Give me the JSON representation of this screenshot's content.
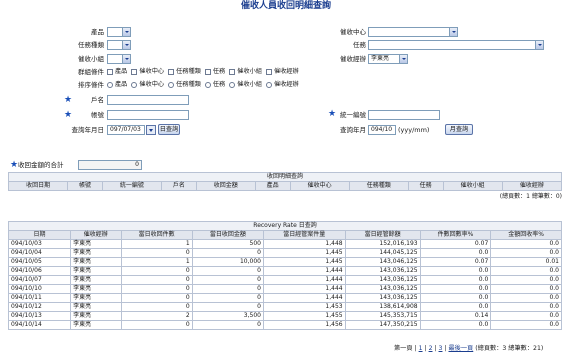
{
  "page": {
    "title": "催收人員收回明細查詢"
  },
  "form": {
    "product": {
      "label": "產品",
      "value": ""
    },
    "collection_center": {
      "label": "催收中心",
      "value": ""
    },
    "task_type": {
      "label": "任務種類",
      "value": ""
    },
    "task": {
      "label": "任務",
      "value": ""
    },
    "collection_team": {
      "label": "催收小組",
      "value": ""
    },
    "collector": {
      "label": "催收經辦",
      "value": "李東亮"
    },
    "group_conditions": {
      "label": "群組條件",
      "options": [
        "產品",
        "催收中心",
        "任務種類",
        "任務",
        "催收小組",
        "催收經辦"
      ]
    },
    "sort_conditions": {
      "label": "排序條件",
      "options": [
        "產品",
        "催收中心",
        "任務種類",
        "任務",
        "催收小組",
        "催收經辦"
      ]
    },
    "account_name": {
      "label": "戶名",
      "value": ""
    },
    "uniform_no": {
      "label": "統一編號",
      "value": ""
    },
    "account_no": {
      "label": "帳號",
      "value": ""
    },
    "query_date": {
      "label": "查詢年月日",
      "value": "097/07/03",
      "button": "日查詢"
    },
    "query_month": {
      "label": "查詢年月",
      "value": "094/10",
      "hint": "(yyy/mm)",
      "button": "月查詢"
    },
    "total_amount": {
      "label": "收回金額的合計",
      "value": "0"
    }
  },
  "detail_table": {
    "caption": "收回明細查詢",
    "columns": [
      "收回日期",
      "帳號",
      "統一編號",
      "戶名",
      "收回金額",
      "產品",
      "催收中心",
      "任務種類",
      "任務",
      "催收小組",
      "催收經辦"
    ],
    "summary": "(總頁數：1 總筆數：0)"
  },
  "rate_table": {
    "caption": "Recovery Rate 日查詢",
    "columns": [
      "日期",
      "催收經辦",
      "當日收回件數",
      "當日收回金額",
      "當日經管案件量",
      "當日經管餘額",
      "件數回數率%",
      "金額回收率%"
    ],
    "rows": [
      [
        "094/10/03",
        "李東亮",
        "1",
        "500",
        "1,448",
        "152,016,193",
        "0.07",
        "0.0"
      ],
      [
        "094/10/04",
        "李東亮",
        "0",
        "0",
        "1,445",
        "144,045,125",
        "0.0",
        "0.0"
      ],
      [
        "094/10/05",
        "李東亮",
        "1",
        "10,000",
        "1,445",
        "143,046,125",
        "0.07",
        "0.01"
      ],
      [
        "094/10/06",
        "李東亮",
        "0",
        "0",
        "1,444",
        "143,036,125",
        "0.0",
        "0.0"
      ],
      [
        "094/10/07",
        "李東亮",
        "0",
        "0",
        "1,444",
        "143,036,125",
        "0.0",
        "0.0"
      ],
      [
        "094/10/10",
        "李東亮",
        "0",
        "0",
        "1,444",
        "143,036,125",
        "0.0",
        "0.0"
      ],
      [
        "094/10/11",
        "李東亮",
        "0",
        "0",
        "1,444",
        "143,036,125",
        "0.0",
        "0.0"
      ],
      [
        "094/10/12",
        "李東亮",
        "0",
        "0",
        "1,453",
        "138,614,908",
        "0.0",
        "0.0"
      ],
      [
        "094/10/13",
        "李東亮",
        "2",
        "3,500",
        "1,455",
        "145,353,715",
        "0.14",
        "0.0"
      ],
      [
        "094/10/14",
        "李東亮",
        "0",
        "0",
        "1,456",
        "147,350,215",
        "0.0",
        "0.0"
      ]
    ]
  },
  "pager": {
    "page_prefix": "第一頁",
    "sep1": "|",
    "page1": "1",
    "sep2": "|",
    "page2": "2",
    "sep3": "|",
    "page3": "3",
    "sep4": "|",
    "last": "最後一頁",
    "summary": "(總頁數：3 總筆數：21)"
  }
}
